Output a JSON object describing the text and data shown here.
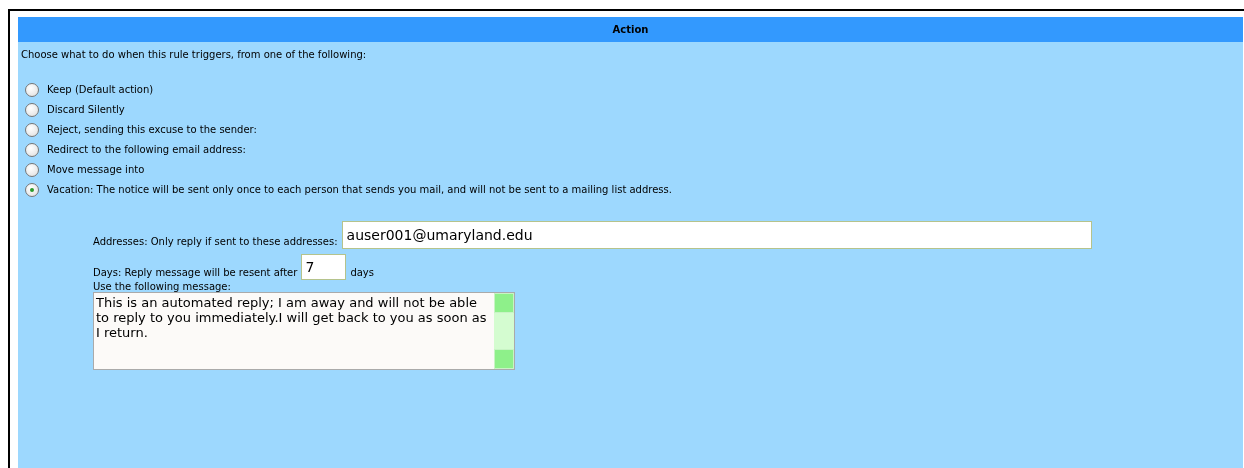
{
  "panel": {
    "title": "Action",
    "intro": "Choose what to do when this rule triggers, from one of the following:",
    "options": [
      {
        "label": "Keep (Default action)",
        "selected": false
      },
      {
        "label": "Discard Silently",
        "selected": false
      },
      {
        "label": "Reject, sending this excuse to the sender:",
        "selected": false
      },
      {
        "label": "Redirect to the following email address:",
        "selected": false
      },
      {
        "label": "Move message into",
        "selected": false
      },
      {
        "label": "Vacation: The notice will be sent only once to each person that sends you mail, and will not be sent to a mailing list address.",
        "selected": true
      }
    ],
    "vacation": {
      "addresses_label": "Addresses: Only reply if sent to these addresses:",
      "addresses_value": "auser001@umaryland.edu",
      "days_label": "Days: Reply message will be resent after",
      "days_value": "7",
      "days_unit": "days",
      "message_label": "Use the following message:",
      "message_value": "This is an automated reply; I am away and will not be able to reply to you immediately.I will get back to you as soon as I return."
    }
  }
}
